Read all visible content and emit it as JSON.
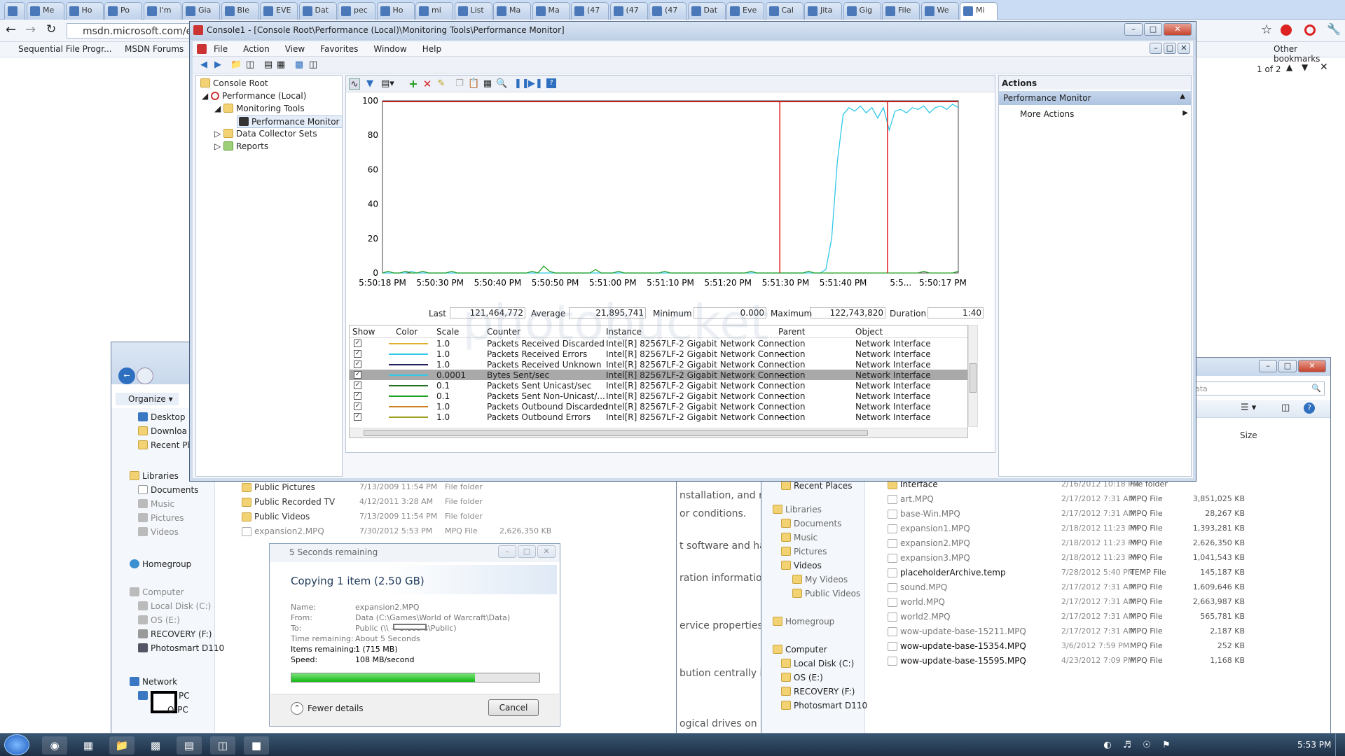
{
  "browser": {
    "tabs": [
      "",
      "Me",
      "Ho",
      "Po",
      "I'm",
      "Gia",
      "Ble",
      "EVE",
      "Dat",
      "pec",
      "Ho",
      "mi",
      "List",
      "Ma",
      "Ma",
      "(47",
      "(47",
      "(47",
      "Dat",
      "Eve",
      "Cal",
      "Jita",
      "Gig",
      "File",
      "We",
      "Mi"
    ],
    "url": "msdn.microsoft.com/e",
    "bookmarks": [
      "Sequential File Progr...",
      "MSDN Forums"
    ],
    "other_bookmarks": "Other bookmarks",
    "find_count": "1 of 2"
  },
  "perfmon": {
    "title": "Console1 - [Console Root\\Performance (Local)\\Monitoring Tools\\Performance Monitor]",
    "menu": [
      "File",
      "Action",
      "View",
      "Favorites",
      "Window",
      "Help"
    ],
    "tree": {
      "root": "Console Root",
      "perf": "Performance (Local)",
      "tools": "Monitoring Tools",
      "monitor": "Performance Monitor",
      "dcs": "Data Collector Sets",
      "reports": "Reports"
    },
    "actions": {
      "header": "Actions",
      "section": "Performance Monitor",
      "more": "More Actions"
    },
    "stats": {
      "last_label": "Last",
      "last": "121,464,772",
      "avg_label": "Average",
      "avg": "21,895,741",
      "min_label": "Minimum",
      "min": "0.000",
      "max_label": "Maximum",
      "max": "122,743,820",
      "dur_label": "Duration",
      "dur": "1:40"
    },
    "columns": [
      "Show",
      "Color",
      "Scale",
      "Counter",
      "Instance",
      "Parent",
      "Object"
    ],
    "rows": [
      {
        "scale": "1.0",
        "counter": "Packets Received Discarded",
        "instance": "Intel[R] 82567LF-2 Gigabit Network Connection",
        "parent": "---",
        "object": "Network Interface",
        "color": "#e0b030"
      },
      {
        "scale": "1.0",
        "counter": "Packets Received Errors",
        "instance": "Intel[R] 82567LF-2 Gigabit Network Connection",
        "parent": "---",
        "object": "Network Interface",
        "color": "#30c8e8"
      },
      {
        "scale": "1.0",
        "counter": "Packets Received Unknown",
        "instance": "Intel[R] 82567LF-2 Gigabit Network Connection",
        "parent": "---",
        "object": "Network Interface",
        "color": "#202060"
      },
      {
        "scale": "0.0001",
        "counter": "Bytes Sent/sec",
        "instance": "Intel[R] 82567LF-2 Gigabit Network Connection",
        "parent": "---",
        "object": "Network Interface",
        "color": "#30c8e8"
      },
      {
        "scale": "0.1",
        "counter": "Packets Sent Unicast/sec",
        "instance": "Intel[R] 82567LF-2 Gigabit Network Connection",
        "parent": "---",
        "object": "Network Interface",
        "color": "#207020"
      },
      {
        "scale": "0.1",
        "counter": "Packets Sent Non-Unicast/...",
        "instance": "Intel[R] 82567LF-2 Gigabit Network Connection",
        "parent": "---",
        "object": "Network Interface",
        "color": "#20a020"
      },
      {
        "scale": "1.0",
        "counter": "Packets Outbound Discarded",
        "instance": "Intel[R] 82567LF-2 Gigabit Network Connection",
        "parent": "---",
        "object": "Network Interface",
        "color": "#d08020"
      },
      {
        "scale": "1.0",
        "counter": "Packets Outbound Errors",
        "instance": "Intel[R] 82567LF-2 Gigabit Network Connection",
        "parent": "---",
        "object": "Network Interface",
        "color": "#a0a020"
      }
    ]
  },
  "chart_data": {
    "type": "line",
    "ylim": [
      0,
      100
    ],
    "yticks": [
      "100",
      "80",
      "60",
      "40",
      "20",
      "0"
    ],
    "xticks": [
      "5:50:18 PM",
      "5:50:30 PM",
      "5:50:40 PM",
      "5:50:50 PM",
      "5:51:00 PM",
      "5:51:10 PM",
      "5:51:20 PM",
      "5:51:30 PM",
      "5:51:40 PM",
      "5:5...",
      "5:50:17 PM"
    ],
    "series": [
      {
        "color": "#30c8e8",
        "values": [
          0,
          0,
          0,
          0,
          0,
          1,
          0,
          0,
          0,
          0,
          0,
          0,
          0,
          0,
          0,
          0,
          0,
          0,
          0,
          0,
          0,
          0,
          0,
          0,
          0,
          0,
          0,
          0,
          0,
          0,
          0,
          0,
          0,
          0,
          0,
          0,
          0,
          0,
          0,
          0,
          0,
          0,
          0,
          0,
          0,
          0,
          0,
          0,
          0,
          0,
          0,
          0,
          0,
          0,
          0,
          0,
          0,
          0,
          0,
          0,
          0,
          0,
          0,
          0,
          0,
          0,
          0,
          0,
          0,
          0,
          0,
          0,
          0,
          0,
          0,
          0,
          0,
          2,
          20,
          65,
          92,
          96,
          94,
          97,
          93,
          96,
          90,
          96,
          83,
          94,
          95,
          93,
          96,
          95,
          97,
          93,
          96,
          97,
          95,
          98,
          96
        ]
      },
      {
        "color": "#20a020",
        "values": [
          0,
          1,
          0,
          0,
          1,
          0,
          0,
          1,
          0,
          0,
          0,
          0,
          1,
          0,
          0,
          0,
          0,
          0,
          0,
          0,
          0,
          0,
          0,
          0,
          0,
          0,
          1,
          0,
          4,
          1,
          0,
          0,
          0,
          0,
          0,
          0,
          0,
          2,
          0,
          0,
          0,
          1,
          0,
          0,
          0,
          0,
          0,
          0,
          0,
          1,
          0,
          0,
          0,
          0,
          0,
          0,
          0,
          0,
          0,
          0,
          0,
          0,
          0,
          0,
          1,
          0,
          0,
          0,
          0,
          0,
          0,
          0,
          0,
          0,
          1,
          0,
          0,
          0,
          0,
          0,
          0,
          0,
          0,
          0,
          0,
          0,
          0,
          0,
          0,
          0,
          0,
          0,
          0,
          0,
          1,
          0,
          0,
          0,
          0,
          0,
          1
        ]
      }
    ]
  },
  "explorer_left": {
    "organize": "Organize",
    "nav": [
      "Desktop",
      "Downloa",
      "Recent Pla"
    ],
    "libraries": "Libraries",
    "lib_items": [
      "Documents",
      "Music",
      "Pictures",
      "Videos"
    ],
    "homegroup": "Homegroup",
    "computer": "Computer",
    "drives": [
      "Local Disk (C:)",
      "OS (E:)",
      "RECOVERY (F:)",
      "Photosmart D110"
    ],
    "network": "Network",
    "net_items": [
      "PC",
      "O-PC"
    ],
    "files": [
      {
        "name": "Public Pictures",
        "date": "7/13/2009 11:54 PM",
        "type": "File folder",
        "size": ""
      },
      {
        "name": "Public Recorded TV",
        "date": "4/12/2011 3:28 AM",
        "type": "File folder",
        "size": ""
      },
      {
        "name": "Public Videos",
        "date": "7/13/2009 11:54 PM",
        "type": "File folder",
        "size": ""
      },
      {
        "name": "expansion2.MPQ",
        "date": "7/30/2012 5:53 PM",
        "type": "MPQ File",
        "size": "2,626,350 KB"
      }
    ]
  },
  "copy_dialog": {
    "title": "5 Seconds remaining",
    "heading": "Copying 1 item (2.50 GB)",
    "labels": [
      "Name:",
      "From:",
      "To:",
      "Time remaining:",
      "Items remaining:",
      "Speed:"
    ],
    "values": [
      "expansion2.MPQ",
      "Data (C:\\Games\\World of Warcraft\\Data)",
      "Public (\\\\           -PC\\Users\\Public)",
      "About 5 Seconds",
      "1 (715 MB)",
      "108 MB/second"
    ],
    "progress": 0.74,
    "fewer": "Fewer details",
    "cancel": "Cancel"
  },
  "msdn_fragments": [
    "nstallation, and ma",
    "or conditions.",
    "t software and ha",
    "ration information",
    "ervice properties.",
    "bution centrally in",
    "ogical drives on a"
  ],
  "explorer_right": {
    "search_placeholder": "ata",
    "size_header": "Size",
    "nav": [
      "Recent Places",
      "Libraries",
      "Documents",
      "Music",
      "Pictures",
      "Videos",
      "My Videos",
      "Public Videos",
      "Homegroup",
      "Computer",
      "Local Disk (C:)",
      "OS (E:)",
      "RECOVERY (F:)",
      "Photosmart D110"
    ],
    "files": [
      {
        "name": "Interface",
        "date": "2/16/2012 10:18 PM",
        "type": "File folder",
        "size": ""
      },
      {
        "name": "art.MPQ",
        "date": "2/17/2012 7:31 AM",
        "type": "MPQ File",
        "size": "3,851,025 KB"
      },
      {
        "name": "base-Win.MPQ",
        "date": "2/17/2012 7:31 AM",
        "type": "MPQ File",
        "size": "28,267 KB"
      },
      {
        "name": "expansion1.MPQ",
        "date": "2/18/2012 11:23 PM",
        "type": "MPQ File",
        "size": "1,393,281 KB"
      },
      {
        "name": "expansion2.MPQ",
        "date": "2/18/2012 11:23 PM",
        "type": "MPQ File",
        "size": "2,626,350 KB"
      },
      {
        "name": "expansion3.MPQ",
        "date": "2/18/2012 11:23 PM",
        "type": "MPQ File",
        "size": "1,041,543 KB"
      },
      {
        "name": "placeholderArchive.temp",
        "date": "7/28/2012 5:40 PM",
        "type": "TEMP File",
        "size": "145,187 KB"
      },
      {
        "name": "sound.MPQ",
        "date": "2/17/2012 7:31 AM",
        "type": "MPQ File",
        "size": "1,609,646 KB"
      },
      {
        "name": "world.MPQ",
        "date": "2/17/2012 7:31 AM",
        "type": "MPQ File",
        "size": "2,663,987 KB"
      },
      {
        "name": "world2.MPQ",
        "date": "2/17/2012 7:31 AM",
        "type": "MPQ File",
        "size": "565,781 KB"
      },
      {
        "name": "wow-update-base-15211.MPQ",
        "date": "2/17/2012 7:31 AM",
        "type": "MPQ File",
        "size": "2,187 KB"
      },
      {
        "name": "wow-update-base-15354.MPQ",
        "date": "3/6/2012 7:59 PM",
        "type": "MPQ File",
        "size": "252 KB"
      },
      {
        "name": "wow-update-base-15595.MPQ",
        "date": "4/23/2012 7:09 PM",
        "type": "MPQ File",
        "size": "1,168 KB"
      }
    ]
  },
  "taskbar": {
    "clock": "5:53 PM"
  }
}
